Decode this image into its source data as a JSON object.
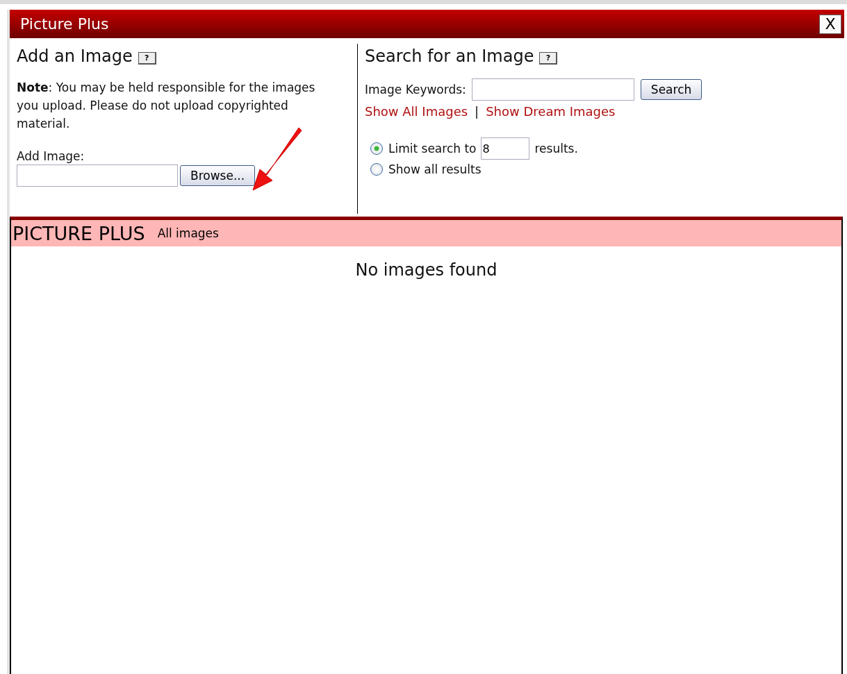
{
  "window": {
    "title": "Picture Plus",
    "close": "X"
  },
  "add_image": {
    "heading": "Add an Image",
    "help": "?",
    "note": "**Note**: You may be held responsible for the images you upload. Please do not upload copyrighted material.",
    "field_label": "Add Image:",
    "browse_button": "Browse..."
  },
  "search": {
    "heading": "Search for an Image",
    "help": "?",
    "keywords_label": "Image Keywords:",
    "search_button": "Search",
    "links": [
      "Show All Images",
      "Show Dream Images"
    ],
    "separator": "|",
    "options": [
      {
        "label_before": "Limit search to",
        "value": "8",
        "label_after": "results.",
        "selected": true
      },
      {
        "label_before": "Show all results",
        "selected": false
      }
    ]
  },
  "results": {
    "title": "PICTURE PLUS",
    "subtitle": "All images",
    "message": "No images found"
  }
}
